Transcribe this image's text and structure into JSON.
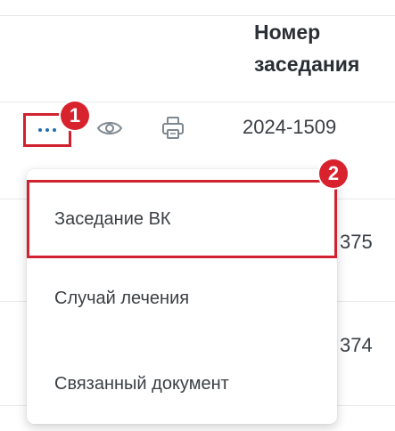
{
  "table": {
    "column_header": "Номер заседания",
    "rows": [
      {
        "number": "2024-1509"
      },
      {
        "number_fragment": "375"
      },
      {
        "number_fragment": "374"
      }
    ]
  },
  "row_actions": {
    "more_icon": "more-horizontal-icon",
    "view_icon": "eye-icon",
    "print_icon": "printer-icon",
    "accent_color": "#1f6fb2"
  },
  "dropdown_menu": {
    "items": [
      {
        "label": "Заседание ВК"
      },
      {
        "label": "Случай лечения"
      },
      {
        "label": "Связанный документ"
      }
    ]
  },
  "callouts": {
    "badge_1": "1",
    "badge_2": "2",
    "color": "#d8222d"
  }
}
